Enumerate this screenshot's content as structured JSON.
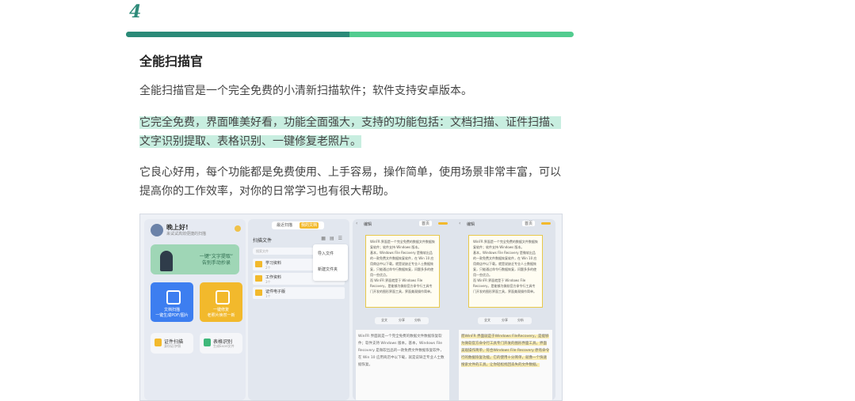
{
  "section_number": "4",
  "accent_colors": {
    "dark": "#2b8a78",
    "light": "#52cc8f",
    "highlight": "#c8eee0"
  },
  "title": "全能扫描官",
  "paragraph1": "全能扫描官是一个完全免费的小清新扫描软件；软件支持安卓版本。",
  "paragraph2": "它完全免费，界面唯美好看，功能全面强大，支持的功能包括：文档扫描、证件扫描、文字识别提取、表格识别、一键修复老照片。",
  "paragraph3": "它良心好用，每个功能都是免费使用、上手容易，操作简单，使用场景非常丰富，可以提高你的工作效率，对你的日常学习也有很大帮助。",
  "screenshot": {
    "pane1": {
      "greeting": "晚上好!",
      "greeting_sub": "来试试高效便捷的扫描",
      "banner_text": "一键“文字提取”\n告别手动抄录",
      "card1_label": "文档扫描\n一键生成PDF/图片",
      "card2_label": "一键修复\n老照片焕然一新",
      "small1_title": "证件扫描",
      "small1_sub": "身份证/护照",
      "small2_title": "表格识别",
      "small2_sub": "生成Excel文件"
    },
    "pane2": {
      "tab1": "最近扫描",
      "tab2": "我的文档",
      "header": "扫描文件",
      "search_placeholder": "搜索文件",
      "files": [
        {
          "name": "学习资料",
          "sub": "2个"
        },
        {
          "name": "工作资料",
          "sub": "3个"
        },
        {
          "name": "证件电子版",
          "sub": "1个"
        }
      ],
      "menu": [
        "导入文件",
        "新建文件夹"
      ]
    },
    "pane3": {
      "title": "编辑",
      "tab": "首页",
      "doc_text": "WinFR 界面是一个完全免费的数据文件数据恢复软件；软件支持 Windows 版本。\n基本，Windows File Recovery 是微软出品的一款免费文件数据恢复软件，在 Win 10 应用商店中以下载。就是说缺乏专业人士数据恢复，只能通过命令行数据恢复，问题多多的使用一些优点。\n而 WinFR 界面就是于 Windows File Recovery，是能够为微软官方命令行工具专门开发的图形界面工具，界面美观操作简单。",
      "seg": [
        "全文",
        "分享",
        "分析"
      ],
      "result_text": "WinFR 界面就是一个完全免费的数据文件数据恢复软件；软件支持 Windows 版本。基本，Windows File Recovery 是微软出品的一款免费文件数据恢复软件，在 Win 10 应用商店中以下载，就是说缺乏专业人士数据恢复。",
      "result_text2": "而WinFR 界面就是于Windows FileRecovery，是能够为微软官方命令行工具专门开发的图形界面工具，界面美观操作简单，符合Windows File Recovery 原有命令行的数据恢复功能。它的使用十分简单，就像一个快速搜索文件的工具，让你轻松找回丢失的文件数据。"
    }
  }
}
